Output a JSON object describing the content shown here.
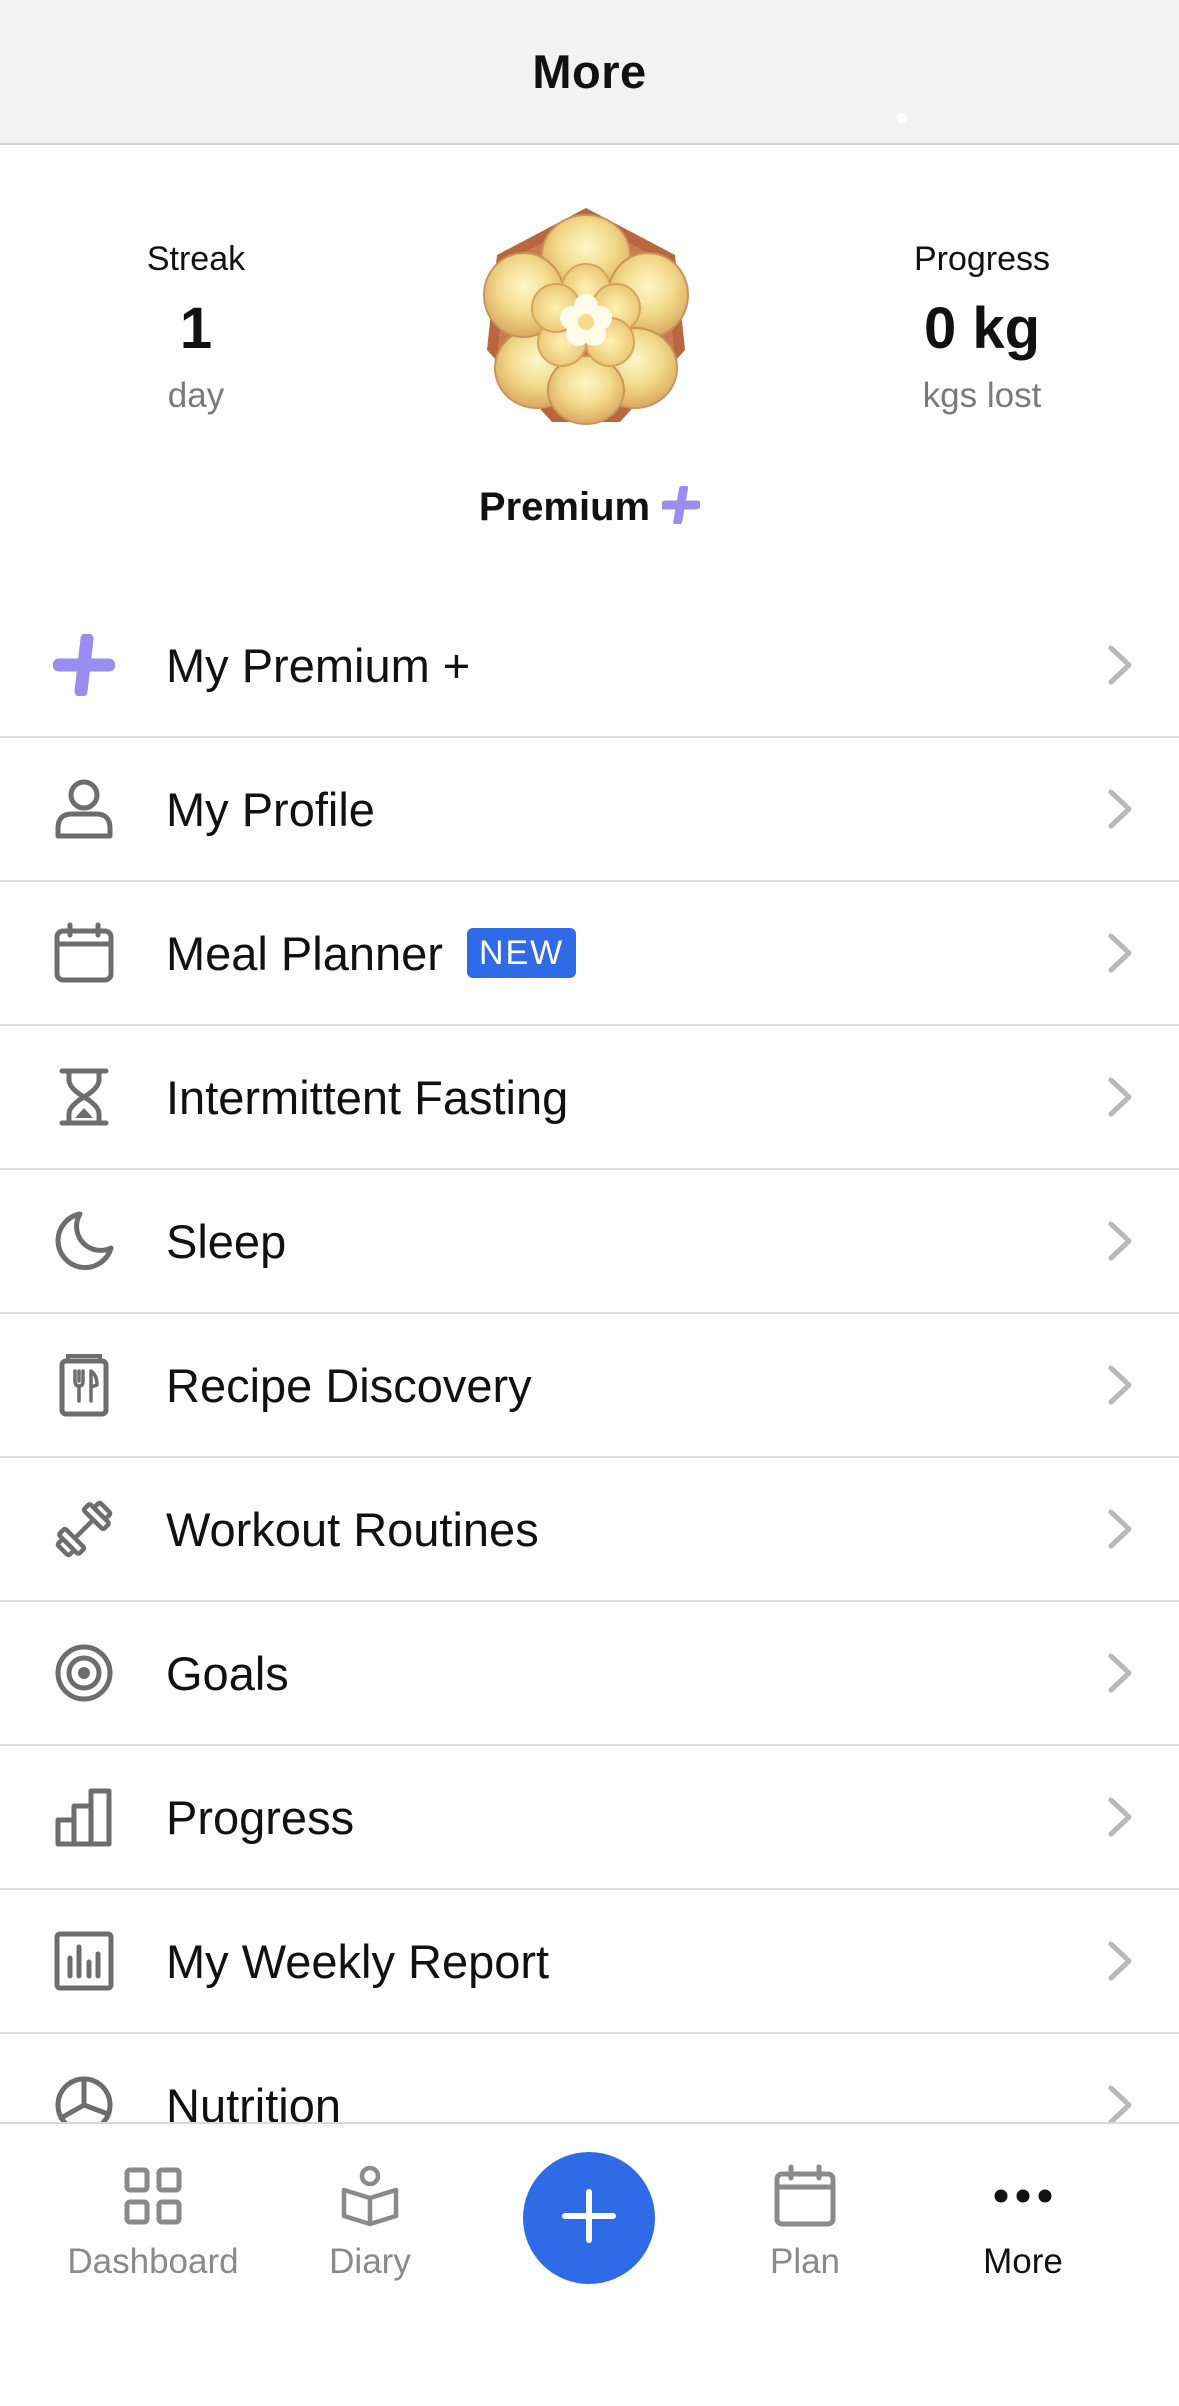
{
  "header": {
    "title": "More"
  },
  "stats": {
    "streak": {
      "label": "Streak",
      "value": "1",
      "unit": "day"
    },
    "progress": {
      "label": "Progress",
      "value": "0 kg",
      "unit": "kgs lost"
    },
    "badge_icon": "flower-badge-icon",
    "premium_label": "Premium",
    "premium_icon": "plus-icon",
    "premium_color": "#9b8cf0"
  },
  "menu": {
    "items": [
      {
        "label": "My Premium +",
        "icon": "premium-plus-icon"
      },
      {
        "label": "My Profile",
        "icon": "person-icon"
      },
      {
        "label": "Meal Planner",
        "icon": "calendar-icon",
        "badge": "NEW"
      },
      {
        "label": "Intermittent Fasting",
        "icon": "hourglass-icon"
      },
      {
        "label": "Sleep",
        "icon": "moon-icon"
      },
      {
        "label": "Recipe Discovery",
        "icon": "recipe-book-icon"
      },
      {
        "label": "Workout Routines",
        "icon": "dumbbell-icon"
      },
      {
        "label": "Goals",
        "icon": "target-icon"
      },
      {
        "label": "Progress",
        "icon": "bar-chart-icon"
      },
      {
        "label": "My Weekly Report",
        "icon": "report-chart-icon"
      },
      {
        "label": "Nutrition",
        "icon": "pie-chart-icon"
      }
    ]
  },
  "tabbar": {
    "dashboard": "Dashboard",
    "diary": "Diary",
    "plan": "Plan",
    "more": "More",
    "active": "more",
    "fab_icon": "plus-icon"
  },
  "colors": {
    "accent_blue": "#2f6be6",
    "premium_purple": "#9b8cf0",
    "muted_text": "#7a7a7a"
  }
}
